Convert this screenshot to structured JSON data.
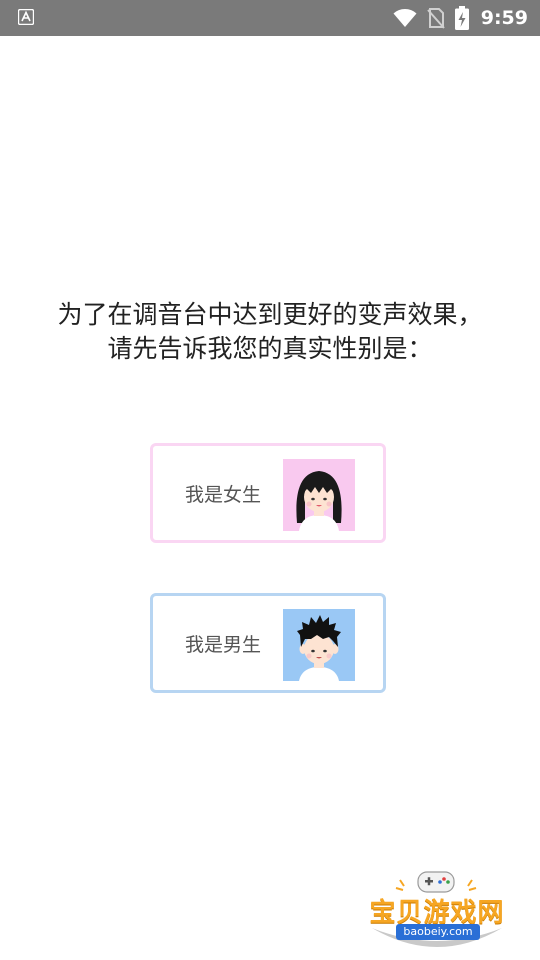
{
  "status_bar": {
    "time": "9:59",
    "left_icon": "a-notification-icon",
    "icons": [
      "wifi-icon",
      "no-sim-icon",
      "battery-charging-icon"
    ]
  },
  "prompt": {
    "line1": "为了在调音台中达到更好的变声效果，",
    "line2": "请先告诉我您的真实性别是："
  },
  "options": {
    "female": {
      "label": "我是女生",
      "border_color": "#fad6f3",
      "avatar_bg": "#f9c9ef",
      "avatar_icon": "girl-avatar-icon"
    },
    "male": {
      "label": "我是男生",
      "border_color": "#b7d5f2",
      "avatar_bg": "#9ac8f5",
      "avatar_icon": "boy-avatar-icon"
    }
  },
  "watermark": {
    "title": "宝贝游戏网",
    "url": "baobeiy.com"
  }
}
